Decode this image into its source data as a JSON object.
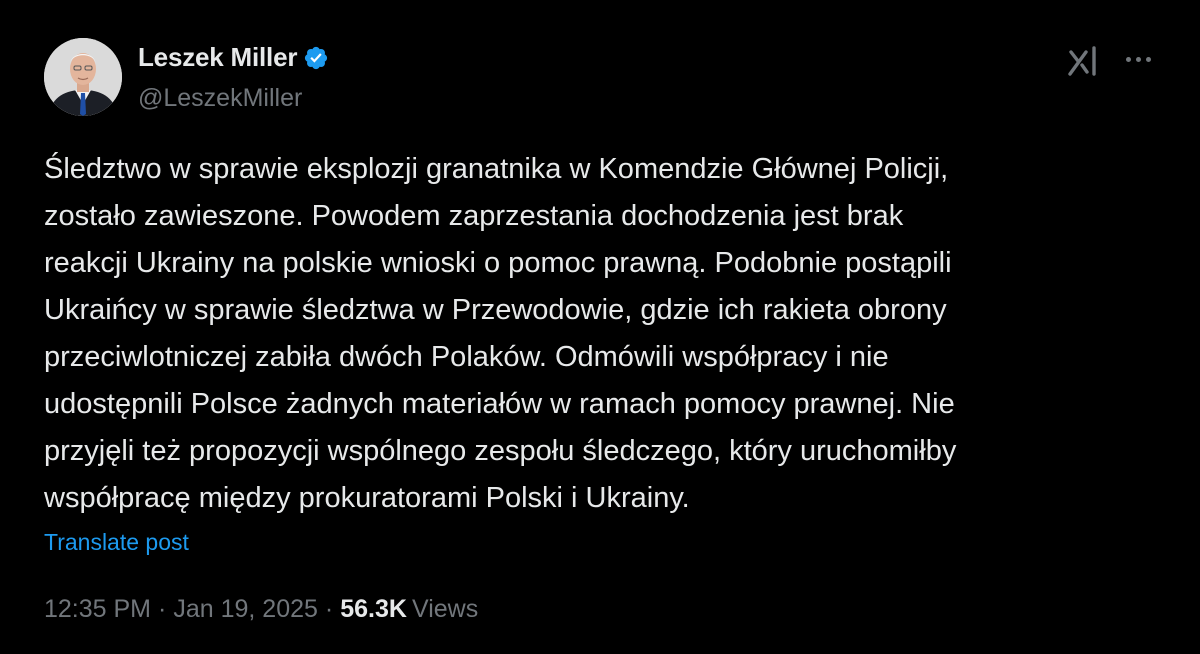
{
  "author": {
    "display_name": "Leszek Miller",
    "handle": "@LeszekMiller",
    "verified_icon": "verified-badge-icon"
  },
  "actions": {
    "grok_icon": "grok-icon",
    "more_icon": "more-options-icon"
  },
  "post": {
    "lines": [
      "Śledztwo w sprawie eksplozji granatnika w Komendzie Głównej Policji,",
      "zostało zawieszone. Powodem zaprzestania dochodzenia jest brak",
      "reakcji Ukrainy na polskie wnioski o pomoc prawną. Podobnie postąpili",
      "Ukraińcy w sprawie śledztwa w Przewodowie, gdzie ich rakieta obrony",
      "przeciwlotniczej zabiła dwóch Polaków. Odmówili współpracy i nie",
      "udostępnili Polsce żadnych materiałów w ramach pomocy prawnej. Nie",
      "przyjęli też propozycji wspólnego zespołu śledczego, który uruchomiłby",
      "współpracę między prokuratorami Polski i Ukrainy."
    ],
    "translate_label": "Translate post"
  },
  "meta": {
    "time": "12:35 PM",
    "separator": "·",
    "date": "Jan 19, 2025",
    "views_count": "56.3K",
    "views_label": "Views"
  },
  "colors": {
    "background": "#000000",
    "text_primary": "#e7e9ea",
    "text_secondary": "#71767b",
    "link": "#1d9bf0",
    "verified": "#1d9bf0"
  }
}
